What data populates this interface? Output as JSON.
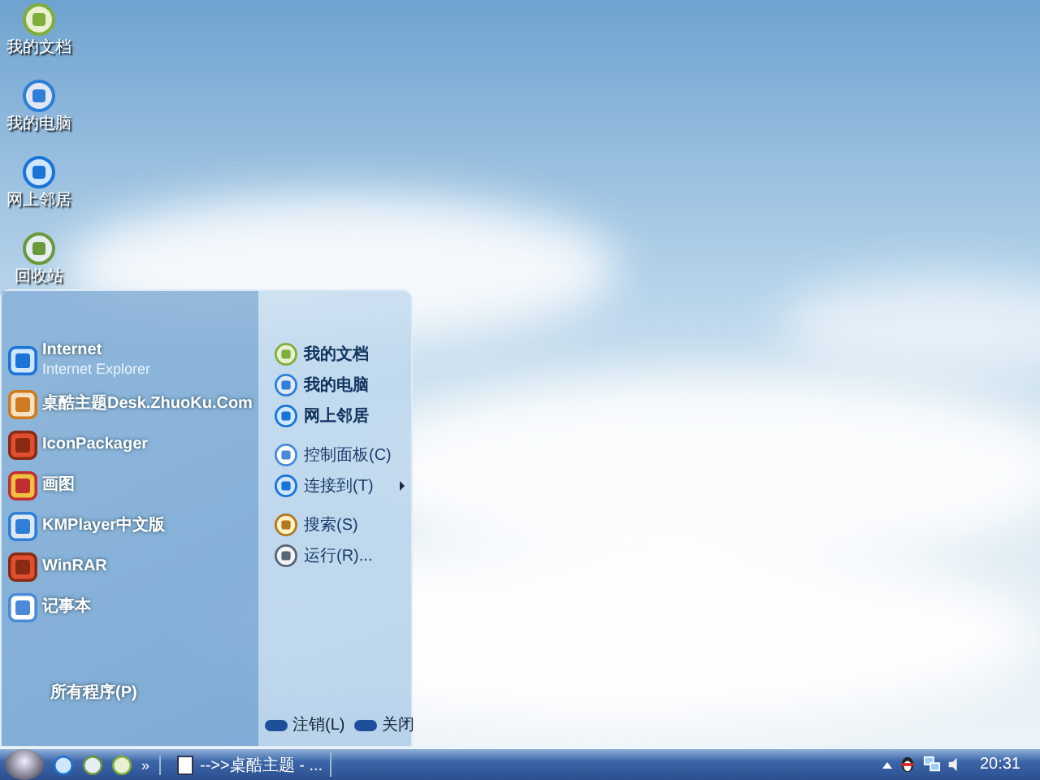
{
  "desktop_icons": [
    {
      "label": "我的文档"
    },
    {
      "label": "我的电脑"
    },
    {
      "label": "网上邻居"
    },
    {
      "label": "回收站"
    }
  ],
  "start_menu": {
    "pinned": [
      {
        "title": "Internet",
        "subtitle": "Internet Explorer"
      },
      {
        "title": "桌酷主题Desk.ZhuoKu.Com"
      },
      {
        "title": "IconPackager"
      },
      {
        "title": "画图"
      },
      {
        "title": "KMPlayer中文版"
      },
      {
        "title": "WinRAR"
      },
      {
        "title": "记事本"
      }
    ],
    "all_programs": "所有程序(P)",
    "place_groups": [
      {
        "items": [
          {
            "label": "我的文档",
            "bold": true,
            "submenu": false
          },
          {
            "label": "我的电脑",
            "bold": true,
            "submenu": false
          },
          {
            "label": "网上邻居",
            "bold": true,
            "submenu": false
          }
        ]
      },
      {
        "items": [
          {
            "label": "控制面板(C)",
            "bold": false,
            "submenu": false
          },
          {
            "label": "连接到(T)",
            "bold": false,
            "submenu": true
          }
        ]
      },
      {
        "items": [
          {
            "label": "搜索(S)",
            "bold": false,
            "submenu": false
          },
          {
            "label": "运行(R)...",
            "bold": false,
            "submenu": false
          }
        ]
      }
    ],
    "power_buttons": [
      {
        "label": "注销(L)"
      },
      {
        "label": "关闭"
      }
    ]
  },
  "taskbar": {
    "more": "»",
    "tasks": [
      {
        "label": "-->>桌酷主题 - ...",
        "selected": false
      }
    ],
    "clock": "20:31"
  }
}
